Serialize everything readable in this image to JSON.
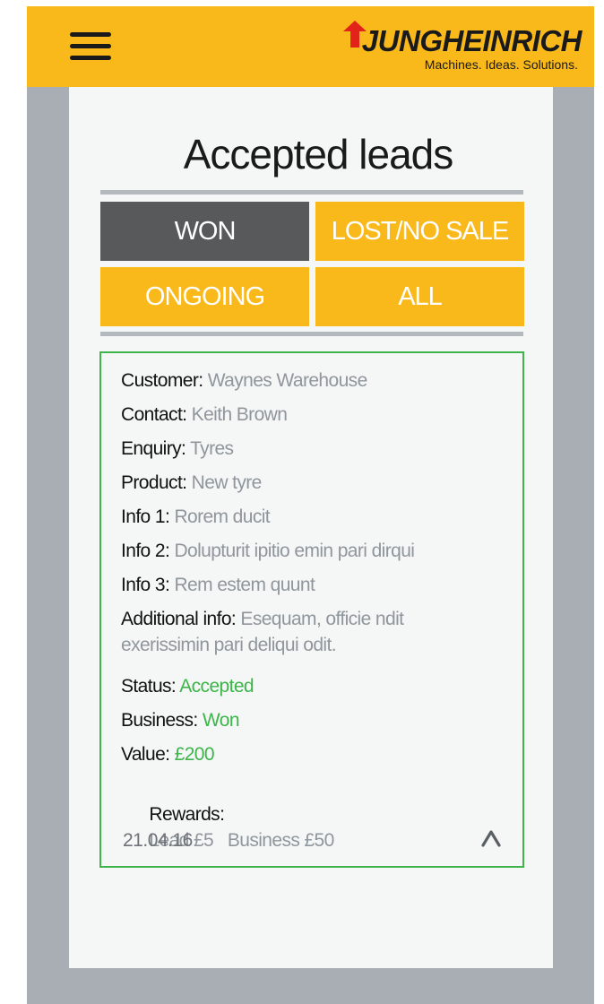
{
  "header": {
    "brand_name": "JUNGHEINRICH",
    "brand_tagline": "Machines. Ideas. Solutions.",
    "brand_color": "#f9b91b",
    "menu_icon": "hamburger-menu-icon"
  },
  "page": {
    "title": "Accepted leads"
  },
  "tabs": [
    {
      "label": "WON",
      "active": true
    },
    {
      "label": "LOST/NO SALE",
      "active": false
    },
    {
      "label": "ONGOING",
      "active": false
    },
    {
      "label": "ALL",
      "active": false
    }
  ],
  "lead": {
    "customer": {
      "label": "Customer:",
      "value": "Waynes Warehouse"
    },
    "contact": {
      "label": "Contact:",
      "value": "Keith Brown"
    },
    "enquiry": {
      "label": "Enquiry:",
      "value": "Tyres"
    },
    "product": {
      "label": "Product:",
      "value": "New tyre"
    },
    "info1": {
      "label": "Info 1:",
      "value": "Rorem ducit"
    },
    "info2": {
      "label": "Info 2:",
      "value": "Dolupturit ipitio emin pari dirqui"
    },
    "info3": {
      "label": "Info 3:",
      "value": "Rem estem quunt"
    },
    "additional": {
      "label": "Additional info:",
      "value": "Esequam, officie ndit exerissimin pari deliqui odit."
    },
    "status": {
      "label": "Status:",
      "value": "Accepted"
    },
    "business": {
      "label": "Business:",
      "value": "Won"
    },
    "amount": {
      "label": "Value:",
      "value": "£200"
    },
    "rewards": {
      "label": "Rewards:",
      "value": "Lead £5   Business £50"
    },
    "date": "21.04.16",
    "collapse_icon": "chevron-up-icon"
  },
  "colors": {
    "accent_yellow": "#f9b91b",
    "active_tab": "#58595b",
    "success_green": "#3db54a",
    "muted_value": "#8f969c",
    "frame_gray": "#a8aeb3"
  }
}
